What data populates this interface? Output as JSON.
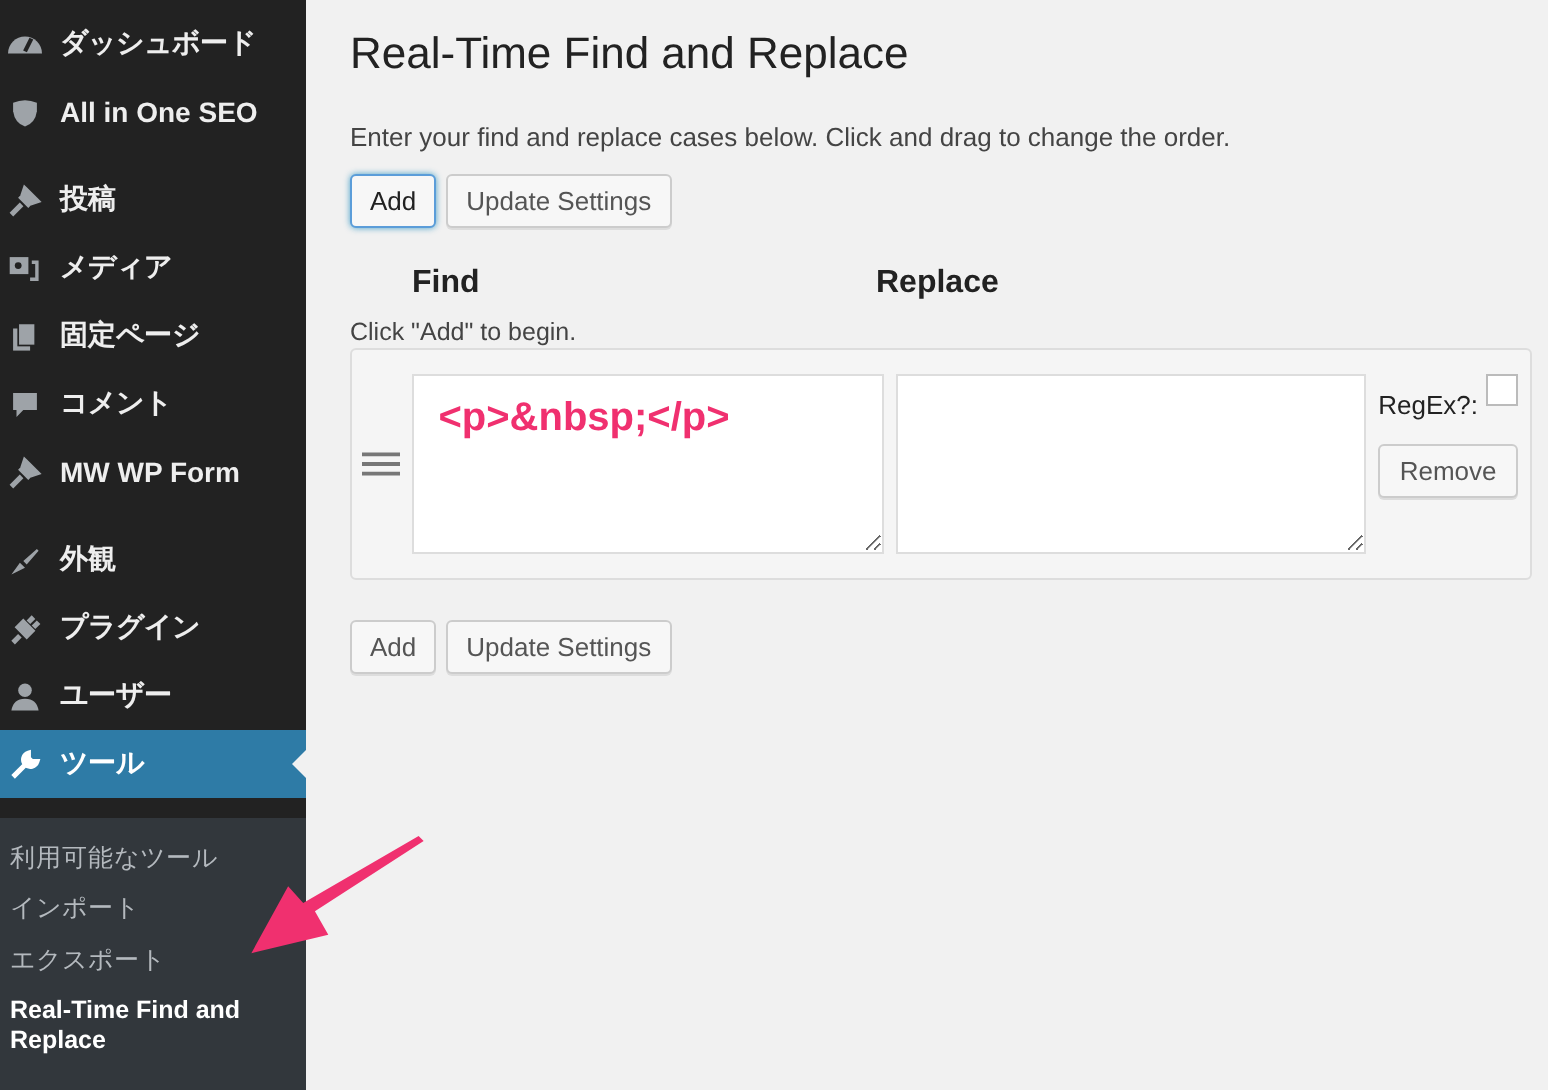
{
  "sidebar": {
    "menu_groups": [
      [
        {
          "label": "ダッシュボード",
          "selected": false
        },
        {
          "label": "All in One SEO",
          "selected": false
        }
      ],
      [
        {
          "label": "投稿",
          "selected": false
        },
        {
          "label": "メディア",
          "selected": false
        },
        {
          "label": "固定ページ",
          "selected": false
        },
        {
          "label": "コメント",
          "selected": false
        },
        {
          "label": "MW WP Form",
          "selected": false
        }
      ],
      [
        {
          "label": "外観",
          "selected": false
        },
        {
          "label": "プラグイン",
          "selected": false
        },
        {
          "label": "ユーザー",
          "selected": false
        },
        {
          "label": "ツール",
          "selected": true
        }
      ]
    ],
    "submenu": [
      {
        "label": "利用可能なツール",
        "selected": false
      },
      {
        "label": "インポート",
        "selected": false
      },
      {
        "label": "エクスポート",
        "selected": false
      },
      {
        "label": "Real-Time Find and Replace",
        "selected": true
      }
    ]
  },
  "main": {
    "title": "Real-Time Find and Replace",
    "description": "Enter your find and replace cases below. Click and drag to change the order.",
    "top_buttons": [
      {
        "label": "Add",
        "focused": true
      },
      {
        "label": "Update Settings",
        "focused": false
      }
    ],
    "columns": [
      "Find",
      "Replace"
    ],
    "hint": "Click \"Add\" to begin.",
    "rows": [
      {
        "find": "<p>&nbsp;</p>",
        "replace": "",
        "regex_label": "RegEx?:",
        "regex": false,
        "remove": "Remove"
      }
    ],
    "bottom_buttons": [
      {
        "label": "Add",
        "focused": false
      },
      {
        "label": "Update Settings",
        "focused": false
      }
    ]
  }
}
